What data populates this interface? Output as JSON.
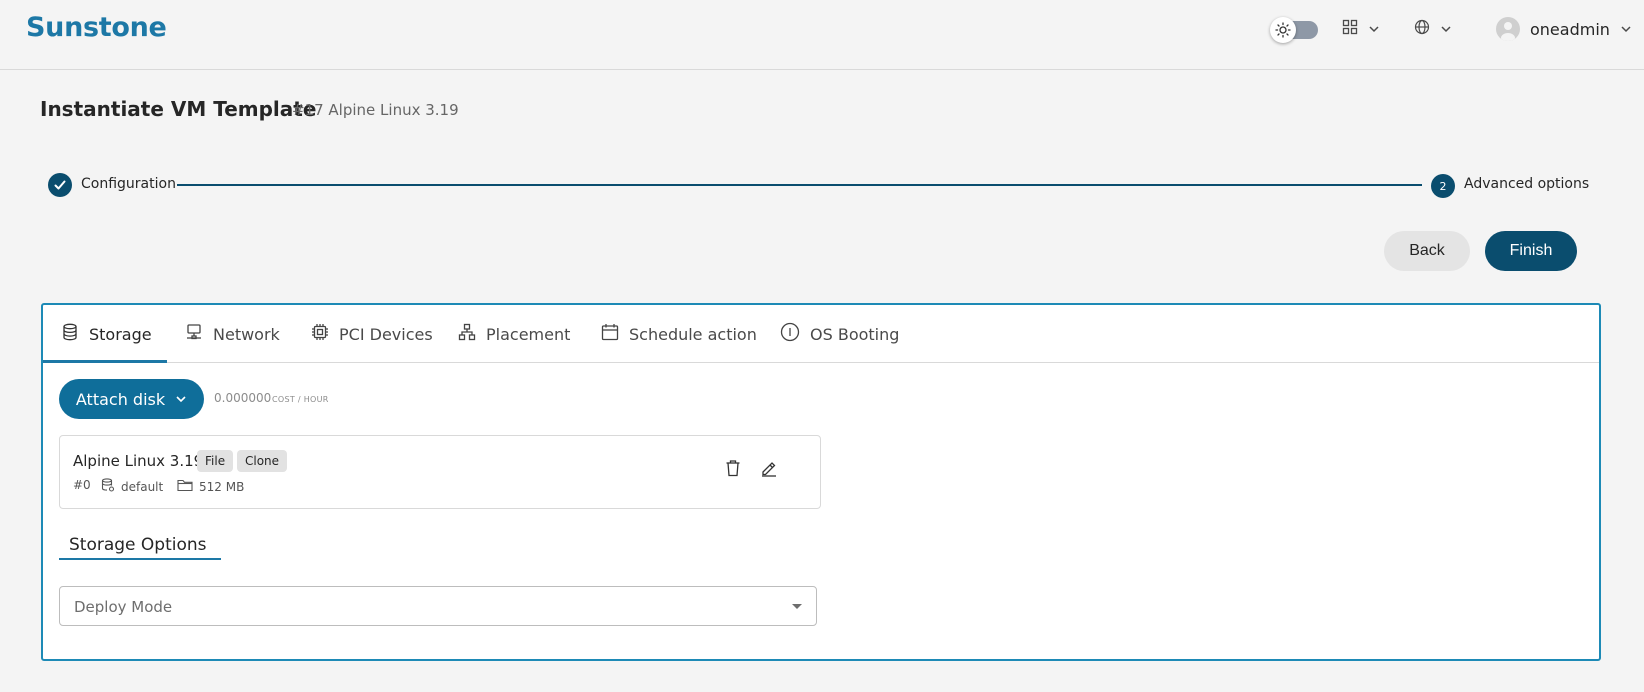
{
  "header": {
    "logo": "Sunstone",
    "user": "oneadmin",
    "icons": [
      "sun-icon",
      "apps-grid-icon",
      "globe-icon",
      "user-avatar-icon"
    ]
  },
  "page": {
    "title": "Instantiate VM Template",
    "subtitle": "#17 Alpine Linux 3.19"
  },
  "stepper": {
    "step1": {
      "label": "Configuration",
      "status": "completed"
    },
    "step2": {
      "number": "2",
      "label": "Advanced options",
      "status": "active"
    }
  },
  "actions": {
    "back": "Back",
    "finish": "Finish"
  },
  "tabs": [
    {
      "label": "Storage",
      "icon": "database-icon",
      "active": true
    },
    {
      "label": "Network",
      "icon": "network-icon"
    },
    {
      "label": "PCI Devices",
      "icon": "cpu-chip-icon"
    },
    {
      "label": "Placement",
      "icon": "hierarchy-icon"
    },
    {
      "label": "Schedule action",
      "icon": "calendar-icon"
    },
    {
      "label": "OS Booting",
      "icon": "info-icon"
    }
  ],
  "storage": {
    "attach_label": "Attach disk",
    "cost_value": "0.000000",
    "cost_unit": "COST / HOUR",
    "disk": {
      "name": "Alpine Linux 3.19",
      "chips": [
        "File",
        "Clone"
      ],
      "id": "#0",
      "datastore": "default",
      "size": "512 MB"
    },
    "options_title": "Storage Options",
    "deploy_mode_placeholder": "Deploy Mode"
  },
  "colors": {
    "brand": "#1d78a6",
    "primary_dark": "#0a4d6e",
    "panel_border": "#1d8ab6"
  }
}
